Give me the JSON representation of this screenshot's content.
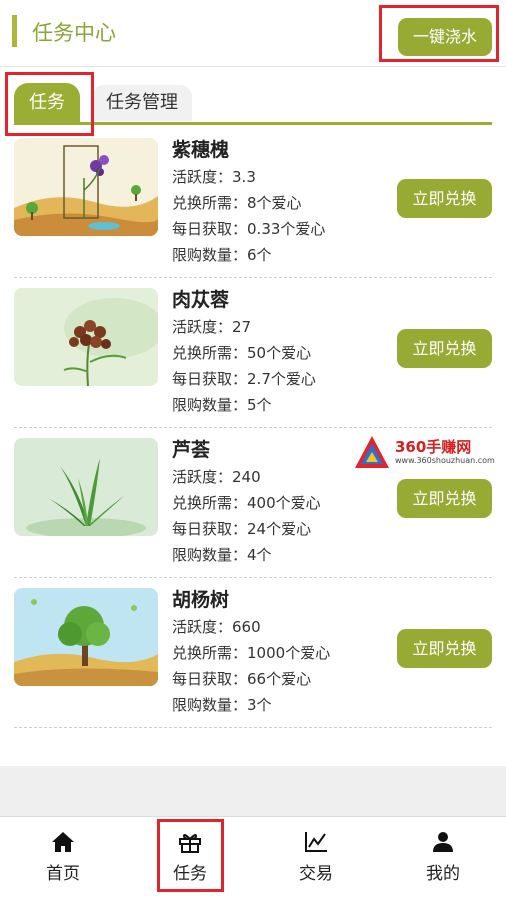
{
  "header": {
    "title": "任务中心",
    "water_button": "一键浇水"
  },
  "tabs": [
    {
      "label": "任务",
      "active": true
    },
    {
      "label": "任务管理",
      "active": false
    }
  ],
  "labels": {
    "activity": "活跃度：",
    "cost": "兑换所需：",
    "daily": "每日获取：",
    "limit": "限购数量："
  },
  "items": [
    {
      "name": "紫穗槐",
      "activity": "3.3",
      "cost": "8个爱心",
      "daily": "0.33个爱心",
      "limit": "6个",
      "button": "立即兑换",
      "image": "purple-flower-plant-image"
    },
    {
      "name": "肉苁蓉",
      "activity": "27",
      "cost": "50个爱心",
      "daily": "2.7个爱心",
      "limit": "5个",
      "button": "立即兑换",
      "image": "cistanche-herb-image"
    },
    {
      "name": "芦荟",
      "activity": "240",
      "cost": "400个爱心",
      "daily": "24个爱心",
      "limit": "4个",
      "button": "立即兑换",
      "image": "aloe-plant-image"
    },
    {
      "name": "胡杨树",
      "activity": "660",
      "cost": "1000个爱心",
      "daily": "66个爱心",
      "limit": "3个",
      "button": "立即兑换",
      "image": "poplar-tree-image"
    }
  ],
  "watermark": {
    "text": "360手赚网",
    "url": "www.360shouzhuan.com"
  },
  "bottom_nav": [
    {
      "label": "首页",
      "icon": "home-icon"
    },
    {
      "label": "任务",
      "icon": "gift-icon"
    },
    {
      "label": "交易",
      "icon": "chart-icon"
    },
    {
      "label": "我的",
      "icon": "user-icon"
    }
  ],
  "colors": {
    "accent": "#97ab34",
    "title": "#8ca53a",
    "highlight": "#e0262c"
  }
}
